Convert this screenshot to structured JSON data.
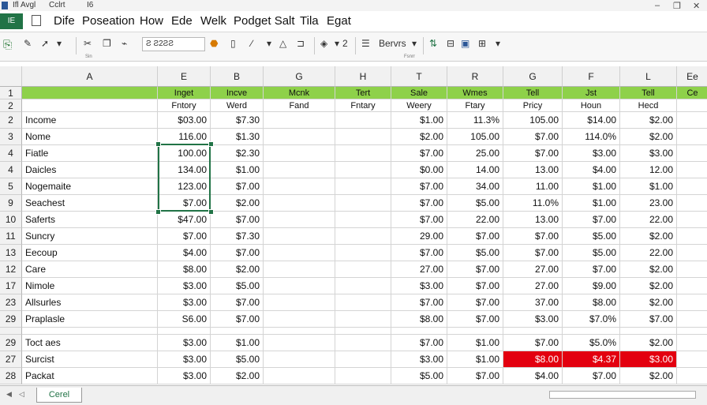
{
  "titlebar": {
    "left_label": "Ifl Avgl",
    "mid_label": "Cclrt",
    "right_label": "I6",
    "minimize": "–",
    "restore": "❐",
    "close": "✕"
  },
  "menubar": {
    "file_label": "IE",
    "items": [
      "Dife",
      "Poseation",
      "How",
      "Ede",
      "Welk",
      "Podget Salt",
      "Tila",
      "Egat"
    ]
  },
  "toolbar": {
    "icons": [
      "paste-icon",
      "format-painter-icon",
      "pointer-icon",
      "cut-icon",
      "copy-icon",
      "brush-icon"
    ],
    "font_box": "Ƨ Ƨ2ƧƧ",
    "font_size": "Ƨ",
    "group_label_left": "Sin",
    "group_label_mid": "Fsnrr",
    "services_label": "Bervrs",
    "align_label": "2"
  },
  "columns": [
    "A",
    "E",
    "B",
    "G",
    "H",
    "T",
    "R",
    "G",
    "F",
    "L",
    "Ee"
  ],
  "rows": [
    {
      "num": "1",
      "green": true,
      "cells": [
        "",
        "Inget",
        "Incve",
        "Mcnk",
        "Tert",
        "Sale",
        "Wmes",
        "Tell",
        "Jst",
        "Tell",
        "Ce"
      ]
    },
    {
      "num": "2",
      "cells": [
        "",
        "Fntory",
        "Werd",
        "Fand",
        "Fntary",
        "Weery",
        "Ftary",
        "Pricy",
        "Houn",
        "Hecd",
        ""
      ]
    },
    {
      "num": "2",
      "cells": [
        "Income",
        "$03.00",
        "$7.30",
        "",
        "",
        "$1.00",
        "11.3%",
        "105.00",
        "$14.00",
        "$2.00",
        ""
      ]
    },
    {
      "num": "3",
      "cells": [
        "Nome",
        "116.00",
        "$1.30",
        "",
        "",
        "$2.00",
        "105.00",
        "$7.00",
        "114.0%",
        "$2.00",
        ""
      ]
    },
    {
      "num": "4",
      "cells": [
        "Fiatle",
        "100.00",
        "$2.30",
        "",
        "",
        "$7.00",
        "25.00",
        "$7.00",
        "$3.00",
        "$3.00",
        ""
      ]
    },
    {
      "num": "4",
      "cells": [
        "Daicles",
        "134.00",
        "$1.00",
        "",
        "",
        "$0.00",
        "14.00",
        "13.00",
        "$4.00",
        "12.00",
        ""
      ]
    },
    {
      "num": "5",
      "cells": [
        "Nogemaite",
        "123.00",
        "$7.00",
        "",
        "",
        "$7.00",
        "34.00",
        "11.00",
        "$1.00",
        "$1.00",
        ""
      ]
    },
    {
      "num": "9",
      "cells": [
        "Seachest",
        "$7.00",
        "$2.00",
        "",
        "",
        "$7.00",
        "$5.00",
        "11.0%",
        "$1.00",
        "23.00",
        ""
      ]
    },
    {
      "num": "10",
      "cells": [
        "Saferts",
        "$47.00",
        "$7.00",
        "",
        "",
        "$7.00",
        "22.00",
        "13.00",
        "$7.00",
        "22.00",
        ""
      ]
    },
    {
      "num": "11",
      "cells": [
        "Suncry",
        "$7.00",
        "$7.30",
        "",
        "",
        "29.00",
        "$7.00",
        "$7.00",
        "$5.00",
        "$2.00",
        ""
      ]
    },
    {
      "num": "13",
      "cells": [
        "Eecoup",
        "$4.00",
        "$7.00",
        "",
        "",
        "$7.00",
        "$5.00",
        "$7.00",
        "$5.00",
        "22.00",
        ""
      ]
    },
    {
      "num": "12",
      "cells": [
        "Care",
        "$8.00",
        "$2.00",
        "",
        "",
        "27.00",
        "$7.00",
        "27.00",
        "$7.00",
        "$2.00",
        ""
      ]
    },
    {
      "num": "17",
      "cells": [
        "Nimole",
        "$3.00",
        "$5.00",
        "",
        "",
        "$3.00",
        "$7.00",
        "27.00",
        "$9.00",
        "$2.00",
        ""
      ]
    },
    {
      "num": "23",
      "cells": [
        "Allsurles",
        "$3.00",
        "$7.00",
        "",
        "",
        "$7.00",
        "$7.00",
        "37.00",
        "$8.00",
        "$2.00",
        ""
      ]
    },
    {
      "num": "29",
      "cells": [
        "Praplasle",
        "S6.00",
        "$7.00",
        "",
        "",
        "$8.00",
        "$7.00",
        "$3.00",
        "$7.0%",
        "$7.00",
        ""
      ]
    },
    {
      "num": "",
      "cells": [
        "",
        "",
        "",
        "",
        "",
        "",
        "",
        "",
        "",
        "",
        ""
      ]
    },
    {
      "num": "29",
      "cells": [
        "Toct aes",
        "$3.00",
        "$1.00",
        "",
        "",
        "$7.00",
        "$1.00",
        "$7.00",
        "$5.0%",
        "$2.00",
        ""
      ]
    },
    {
      "num": "27",
      "red_from": 7,
      "cells": [
        "Surcist",
        "$3.00",
        "$5.00",
        "",
        "",
        "$3.00",
        "$1.00",
        "$8.00",
        "$4.37",
        "$3.00",
        ""
      ]
    },
    {
      "num": "28",
      "cells": [
        "Packat",
        "$3.00",
        "$2.00",
        "",
        "",
        "$5.00",
        "$7.00",
        "$4.00",
        "$7.00",
        "$2.00",
        ""
      ]
    }
  ],
  "sheetbar": {
    "tab_label": "Cerel",
    "prev": "◀",
    "next": "◁"
  },
  "colors": {
    "accent": "#217346",
    "header_green": "#8ed14a",
    "highlight_red": "#e3000f"
  }
}
